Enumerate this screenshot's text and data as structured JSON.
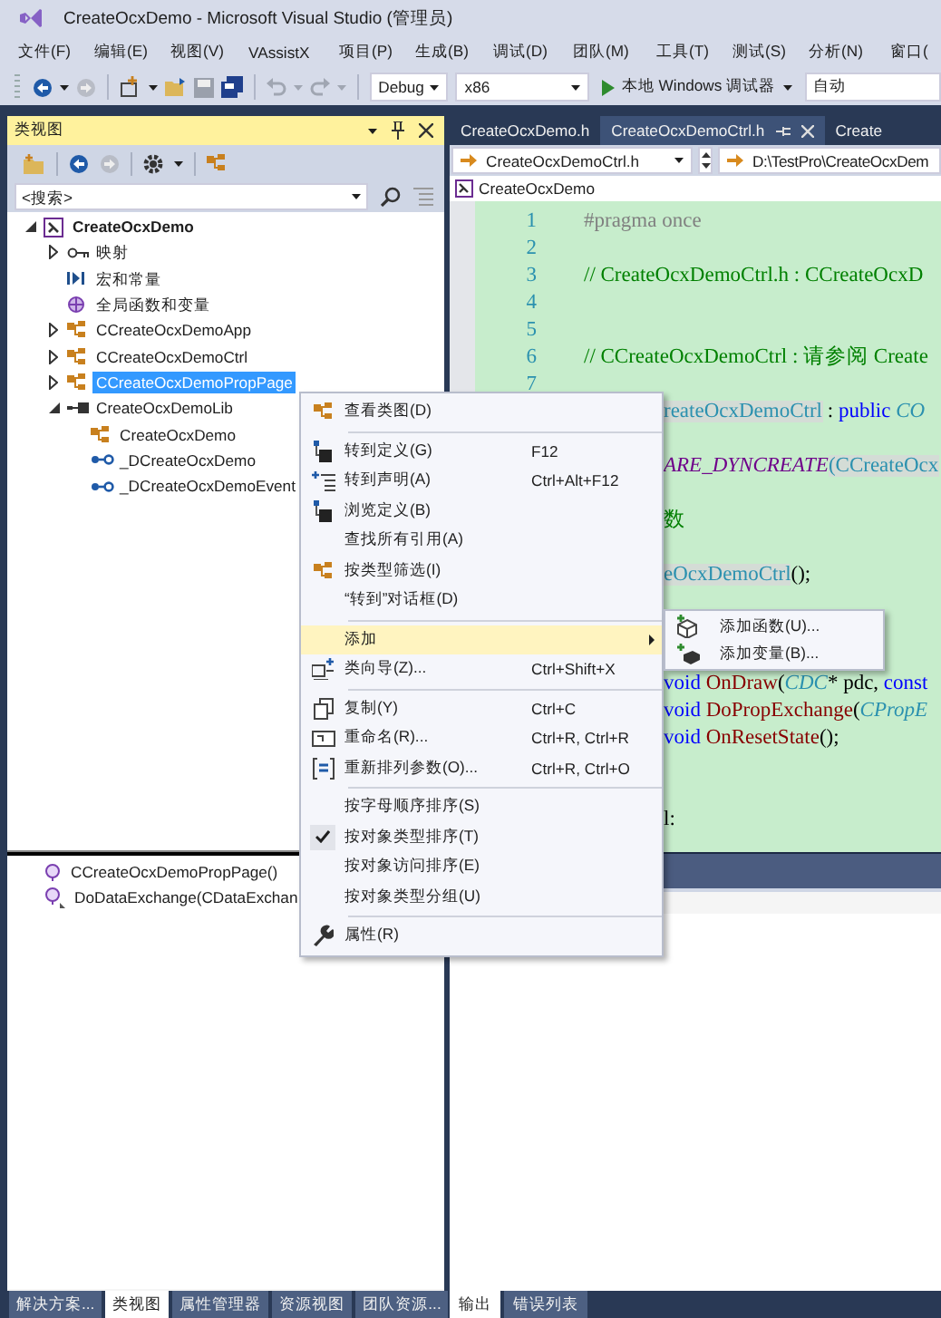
{
  "window": {
    "title": "CreateOcxDemo - Microsoft Visual Studio (管理员)"
  },
  "menu_bar": [
    "文件(F)",
    "编辑(E)",
    "视图(V)",
    "VAssistX",
    "项目(P)",
    "生成(B)",
    "调试(D)",
    "团队(M)",
    "工具(T)",
    "测试(S)",
    "分析(N)",
    "窗口("
  ],
  "toolbar": {
    "configuration": "Debug",
    "platform": "x86",
    "run_button": "本地 Windows 调试器",
    "target": "自动"
  },
  "class_view": {
    "title": "类视图",
    "search": {
      "placeholder": "<搜索>"
    },
    "tree": [
      {
        "label": "CreateOcxDemo",
        "kind": "project",
        "expanded": true,
        "selected": false,
        "children": [
          {
            "label": "映射",
            "kind": "map",
            "expanded": false,
            "selected": false
          },
          {
            "label": "宏和常量",
            "kind": "macro",
            "selected": false
          },
          {
            "label": "全局函数和变量",
            "kind": "global",
            "selected": false
          },
          {
            "label": "CCreateOcxDemoApp",
            "kind": "class",
            "expanded": false,
            "selected": false
          },
          {
            "label": "CCreateOcxDemoCtrl",
            "kind": "class",
            "expanded": false,
            "selected": false
          },
          {
            "label": "CCreateOcxDemoPropPage",
            "kind": "class",
            "expanded": false,
            "selected": true
          },
          {
            "label": "CreateOcxDemoLib",
            "kind": "library",
            "expanded": true,
            "selected": false,
            "children": [
              {
                "label": "CreateOcxDemo",
                "kind": "class",
                "selected": false
              },
              {
                "label": "_DCreateOcxDemo",
                "kind": "interface",
                "selected": false
              },
              {
                "label": "_DCreateOcxDemoEvent",
                "kind": "interface",
                "selected": false
              }
            ]
          }
        ]
      }
    ],
    "members": [
      {
        "label": "CCreateOcxDemoPropPage()",
        "kind": "method"
      },
      {
        "label": "DoDataExchange(CDataExchan",
        "kind": "protected_method"
      }
    ],
    "bottom_tabs": [
      {
        "label": "解决方案...",
        "selected": false
      },
      {
        "label": "类视图",
        "selected": true
      },
      {
        "label": "属性管理器",
        "selected": false
      },
      {
        "label": "资源视图",
        "selected": false
      },
      {
        "label": "团队资源...",
        "selected": false
      }
    ]
  },
  "editor": {
    "tabs": [
      {
        "label": "CreateOcxDemo.h",
        "selected": false
      },
      {
        "label": "CreateOcxDemoCtrl.h",
        "selected": true
      },
      {
        "label": "Create",
        "selected": false
      }
    ],
    "file_dropdown": "CreateOcxDemoCtrl.h",
    "path_dropdown": "D:\\TestPro\\CreateOcxDem",
    "scope": "CreateOcxDemo",
    "lines": [
      {
        "kind": "numbered",
        "number": "1",
        "segments": [
          {
            "kind": "preproc",
            "text": "#pragma once"
          }
        ]
      },
      {
        "kind": "numbered",
        "number": "2"
      },
      {
        "kind": "numbered",
        "number": "3",
        "segments": [
          {
            "kind": "comment",
            "text": "// CreateOcxDemoCtrl.h : CCreateOcxD"
          }
        ]
      },
      {
        "kind": "numbered",
        "number": "4"
      },
      {
        "kind": "numbered",
        "number": "5"
      },
      {
        "kind": "numbered",
        "number": "6",
        "segments": [
          {
            "kind": "comment",
            "text": "// CCreateOcxDemoCtrl : 请参阅 Create"
          }
        ]
      },
      {
        "kind": "numbered",
        "number": "7"
      },
      {
        "kind": "covered",
        "segments": [
          {
            "kind": "ref",
            "text": "reateOcxDemoCtrl"
          },
          {
            "kind": "plain",
            "text": " : "
          },
          {
            "kind": "keyword",
            "text": "public"
          },
          {
            "kind": "type",
            "text": " CO"
          }
        ]
      },
      {
        "kind": "blank"
      },
      {
        "kind": "covered",
        "segments": [
          {
            "kind": "macro",
            "text": "ARE_DYNCREATE"
          },
          {
            "kind": "ref",
            "text": "(CCreateOcx"
          }
        ]
      },
      {
        "kind": "blank"
      },
      {
        "kind": "covered",
        "segments": [
          {
            "kind": "comment",
            "text": "数"
          }
        ]
      },
      {
        "kind": "blank"
      },
      {
        "kind": "covered",
        "segments": [
          {
            "kind": "ref",
            "text": "eOcxDemoCtrl"
          },
          {
            "kind": "plain",
            "text": "();"
          }
        ]
      },
      {
        "kind": "blank"
      },
      {
        "kind": "blank"
      },
      {
        "kind": "blank"
      },
      {
        "kind": "covered",
        "segments": [
          {
            "kind": "keyword",
            "text": "void "
          },
          {
            "kind": "func",
            "text": "OnDraw"
          },
          {
            "kind": "plain",
            "text": "("
          },
          {
            "kind": "type",
            "text": "CDC"
          },
          {
            "kind": "plain",
            "text": "* pdc, "
          },
          {
            "kind": "keyword",
            "text": "const"
          }
        ]
      },
      {
        "kind": "covered",
        "segments": [
          {
            "kind": "keyword",
            "text": "void "
          },
          {
            "kind": "func",
            "text": "DoPropExchange"
          },
          {
            "kind": "plain",
            "text": "("
          },
          {
            "kind": "type",
            "text": "CPropE"
          }
        ]
      },
      {
        "kind": "covered",
        "segments": [
          {
            "kind": "keyword",
            "text": "void "
          },
          {
            "kind": "func",
            "text": "OnResetState"
          },
          {
            "kind": "plain",
            "text": "();"
          }
        ]
      },
      {
        "kind": "blank"
      },
      {
        "kind": "blank"
      },
      {
        "kind": "covered",
        "segments": [
          {
            "kind": "plain",
            "text": "l:"
          }
        ]
      }
    ]
  },
  "output": {
    "bottom_tabs": [
      {
        "label": "输出",
        "selected": true
      },
      {
        "label": "错误列表",
        "selected": false
      }
    ]
  },
  "context_menu": {
    "groups": [
      [
        {
          "label": "查看类图(D)",
          "kind": "class",
          "selected": false,
          "checked": false
        }
      ],
      [
        {
          "label": "转到定义(G)",
          "shortcut": "F12",
          "kind": "goto_def",
          "selected": false,
          "checked": false
        },
        {
          "label": "转到声明(A)",
          "shortcut": "Ctrl+Alt+F12",
          "kind": "goto_decl",
          "selected": false,
          "checked": false
        },
        {
          "label": "浏览定义(B)",
          "kind": "goto_def",
          "selected": false,
          "checked": false
        },
        {
          "label": "查找所有引用(A)",
          "kind": "plain",
          "selected": false,
          "checked": false
        },
        {
          "label": "按类型筛选(I)",
          "kind": "class",
          "selected": false,
          "checked": false
        },
        {
          "label": "“转到”对话框(D)",
          "kind": "plain",
          "selected": false,
          "checked": false
        }
      ],
      [
        {
          "label": "添加",
          "kind": "submenu",
          "selected": true,
          "checked": false
        },
        {
          "label": "类向导(Z)...",
          "shortcut": "Ctrl+Shift+X",
          "kind": "wizard",
          "selected": false,
          "checked": false
        }
      ],
      [
        {
          "label": "复制(Y)",
          "shortcut": "Ctrl+C",
          "kind": "copy",
          "selected": false,
          "checked": false
        },
        {
          "label": "重命名(R)...",
          "shortcut": "Ctrl+R, Ctrl+R",
          "kind": "rename",
          "selected": false,
          "checked": false
        },
        {
          "label": "重新排列参数(O)...",
          "shortcut": "Ctrl+R, Ctrl+O",
          "kind": "reorder",
          "selected": false,
          "checked": false
        }
      ],
      [
        {
          "label": "按字母顺序排序(S)",
          "kind": "plain",
          "selected": false,
          "checked": false
        },
        {
          "label": "按对象类型排序(T)",
          "kind": "plain",
          "selected": false,
          "checked": true
        },
        {
          "label": "按对象访问排序(E)",
          "kind": "plain",
          "selected": false,
          "checked": false
        },
        {
          "label": "按对象类型分组(U)",
          "kind": "plain",
          "selected": false,
          "checked": false
        }
      ],
      [
        {
          "label": "属性(R)",
          "kind": "wrench",
          "selected": false,
          "checked": false
        }
      ]
    ],
    "submenu": {
      "items": [
        {
          "label": "添加函数(U)...",
          "kind": "add_function"
        },
        {
          "label": "添加变量(B)...",
          "kind": "add_variable"
        }
      ]
    }
  }
}
